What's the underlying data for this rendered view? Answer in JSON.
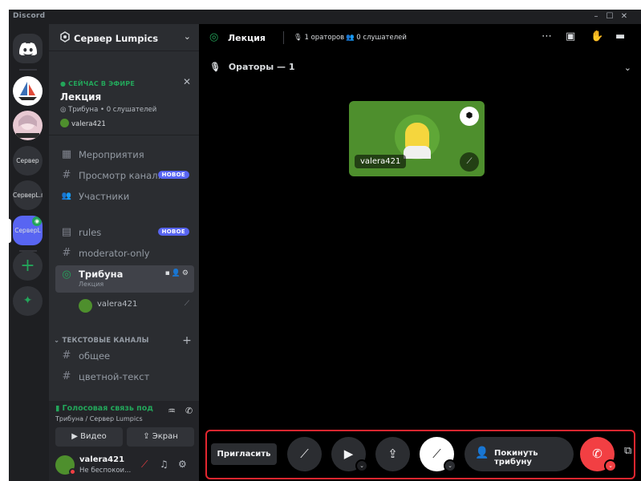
{
  "window": {
    "app_title": "Discord",
    "controls": [
      "–",
      "☐",
      "✕"
    ]
  },
  "rail": {
    "servers": [
      {
        "label": "",
        "icon": "boat-icon"
      },
      {
        "label": "",
        "icon": "anime-avatar-icon"
      },
      {
        "label": "Сервер"
      },
      {
        "label": "СерверL.г"
      },
      {
        "label": "СерверL"
      }
    ],
    "add_label": "+",
    "explore_label": "✦"
  },
  "sidebar": {
    "server_name": "Сервер Lumpics",
    "live": {
      "badge": "● СЕЙЧАС В ЭФИРЕ",
      "event_name": "Лекция",
      "meta": "Трибуна • 0 слушателей",
      "user": "valera421"
    },
    "nav": [
      {
        "label": "Мероприятия",
        "glyph": "▦"
      },
      {
        "label": "Просмотр канал...",
        "glyph": "#",
        "badge": "НОВОЕ"
      },
      {
        "label": "Участники",
        "glyph": "👥"
      }
    ],
    "channels": [
      {
        "label": "rules",
        "glyph": "▤",
        "badge": "НОВОЕ"
      },
      {
        "label": "moderator-only",
        "glyph": "#"
      }
    ],
    "stage_channel": {
      "label": "Трибуна",
      "sub": "Лекция"
    },
    "stage_user": "valera421",
    "text_category": "ТЕКСТОВЫЕ КАНАЛЫ",
    "text_channels": [
      {
        "label": "общее",
        "glyph": "#"
      },
      {
        "label": "цветной-текст",
        "glyph": "#"
      }
    ],
    "voice_panel": {
      "status": "Голосовая связь под",
      "location": "Трибуна / Сервер Lumpics",
      "video_label": "Видео",
      "screen_label": "Экран"
    },
    "user_panel": {
      "username": "valera421",
      "status": "Не беспокои..."
    }
  },
  "main": {
    "title": "Лекция",
    "speakers_count": "1 ораторов",
    "listeners_count": "0 слушателей",
    "speakers_header": "Ораторы — 1",
    "tile_name": "valera421"
  },
  "controls": {
    "invite_label": "Пригласить",
    "leave_label": "Покинуть трибуну"
  },
  "colors": {
    "accent": "#5865f2",
    "live_green": "#23a55a",
    "danger": "#f23f43",
    "highlight_border": "#e3262f",
    "tile_bg": "#4e8f2d"
  }
}
